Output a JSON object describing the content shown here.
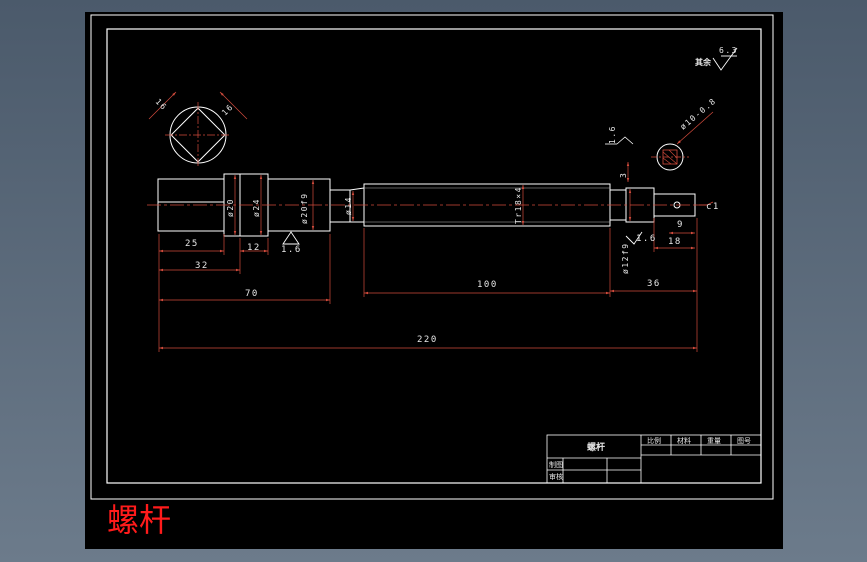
{
  "caption": "螺杆",
  "surface_note": {
    "label": "其余",
    "value": "6.3"
  },
  "section_view": {
    "width_a": "16",
    "width_b": "16"
  },
  "keyway": {
    "diameter": "ø10-0.8",
    "depth": "3",
    "roughness": "1.6"
  },
  "dimensions": {
    "d20": "ø20",
    "d24": "ø24",
    "d20f9": "ø20f9",
    "d14": "ø14",
    "thread": "Tr18×4",
    "d12f9": "ø12f9",
    "l25": "25",
    "l12": "12",
    "r16_left": "1.6",
    "l32": "32",
    "l70": "70",
    "l100": "100",
    "l36": "36",
    "l220": "220",
    "r16_right": "1.6",
    "l18": "18",
    "l9": "9",
    "chamfer": "c1"
  },
  "title_block": {
    "part_name": "螺杆",
    "col_scale": "比例",
    "col_material": "材料",
    "col_weight": "重量",
    "col_drawing_no": "图号",
    "row_drawn": "制图",
    "row_checked": "审核"
  },
  "colors": {
    "geometry": "#ffffff",
    "dimension": "#d24b3c",
    "centerline": "#d24b3c",
    "caption": "#ff1b1b",
    "background": "#000000"
  }
}
